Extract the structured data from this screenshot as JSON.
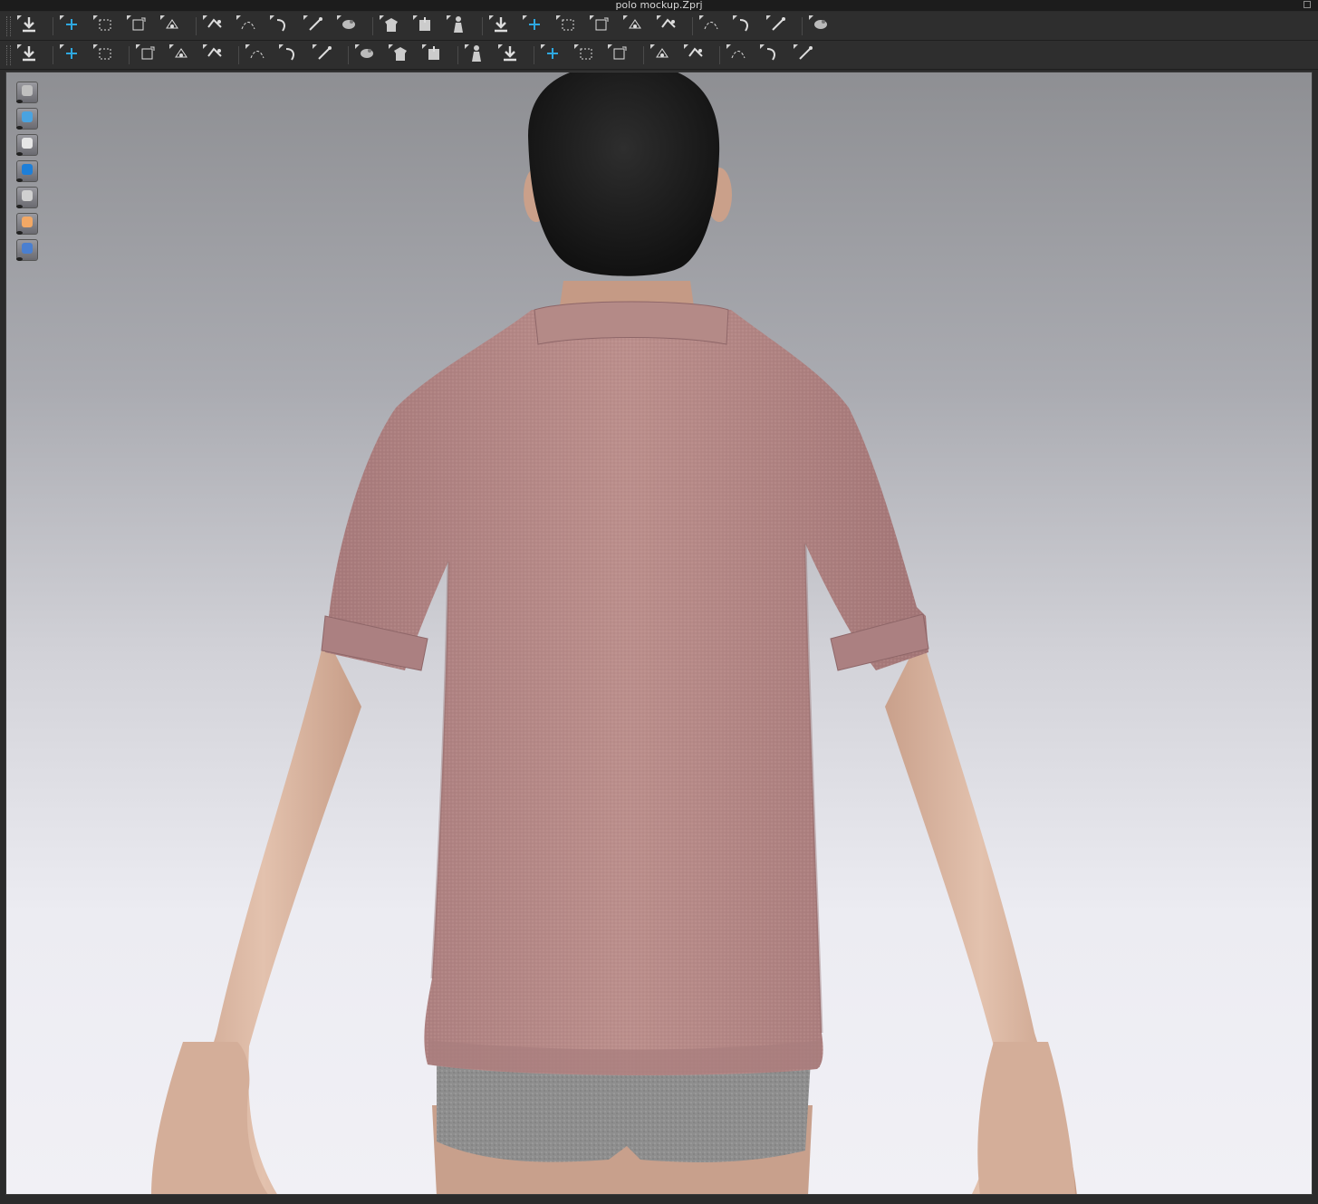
{
  "window": {
    "title": "polo mockup.Zprj"
  },
  "toolbar_row1": [
    {
      "name": "simulation-tool",
      "icon": "down-arrow-icon"
    },
    {
      "name": "select-move-tool",
      "icon": "select-cross-icon"
    },
    {
      "name": "select-mesh-box-tool",
      "icon": "box-select-icon"
    },
    {
      "name": "transform-tool",
      "icon": "transform-icon"
    },
    {
      "name": "fold-arrangement-tool",
      "icon": "fold-icon"
    },
    {
      "name": "edit-pattern-tool",
      "icon": "edit-pattern-icon"
    },
    {
      "name": "edit-curve-tool",
      "icon": "curve-icon"
    },
    {
      "name": "edit-sewing-tool",
      "icon": "sewing-icon"
    },
    {
      "name": "pin-tool",
      "icon": "pin-icon"
    },
    {
      "name": "tack-tool",
      "icon": "tack-icon"
    },
    {
      "name": "garment-fit-tool",
      "icon": "shirt-icon"
    },
    {
      "name": "arrangement-tool",
      "icon": "arrangement-icon"
    },
    {
      "name": "show-avatar-tool",
      "icon": "person-icon"
    },
    {
      "name": "shirt-up-tool",
      "icon": "shirt-up-icon"
    },
    {
      "name": "shirt-updown-tool",
      "icon": "shirt-updown-icon"
    },
    {
      "name": "shirt-down-tool",
      "icon": "shirt-down-icon"
    },
    {
      "name": "layer-tool",
      "icon": "layer-icon"
    },
    {
      "name": "stack-tool",
      "icon": "stack-icon"
    },
    {
      "name": "tape-tool",
      "icon": "tape-icon"
    },
    {
      "name": "steam-tool",
      "icon": "steam-icon"
    },
    {
      "name": "measure-tool",
      "icon": "measure-icon"
    },
    {
      "name": "circumference-tool",
      "icon": "ring-icon"
    },
    {
      "name": "ruler-tool",
      "icon": "ruler-icon"
    }
  ],
  "toolbar_row2": [
    {
      "name": "pose-tool",
      "icon": "walking-person-icon"
    },
    {
      "name": "brush-tool",
      "icon": "brush-icon"
    },
    {
      "name": "needle-tool",
      "icon": "needle-icon"
    },
    {
      "name": "line-stitch-tool",
      "icon": "stitch-icon"
    },
    {
      "name": "cross-stitch-tool",
      "icon": "cross-stitch-icon"
    },
    {
      "name": "copy-pattern-tool",
      "icon": "copy-icon"
    },
    {
      "name": "texture-tool",
      "icon": "texture-icon"
    },
    {
      "name": "fabric-tool",
      "icon": "fabric-icon"
    },
    {
      "name": "graphic-tool",
      "icon": "graphic-icon"
    },
    {
      "name": "button-tool",
      "icon": "button-icon"
    },
    {
      "name": "buttonhole-tool",
      "icon": "buttonhole-icon"
    },
    {
      "name": "topstitch-tool",
      "icon": "topstitch-icon"
    },
    {
      "name": "zipper-pull-tool",
      "icon": "zipper-pull-icon"
    },
    {
      "name": "zipper-tool",
      "icon": "zipper-icon"
    },
    {
      "name": "puckering-tool",
      "icon": "puckering-icon"
    },
    {
      "name": "piping-tool",
      "icon": "piping-icon"
    },
    {
      "name": "elastic-tool",
      "icon": "elastic-icon"
    },
    {
      "name": "fold-tool",
      "icon": "fold-line-icon"
    },
    {
      "name": "resize-tool",
      "icon": "resize-icon"
    },
    {
      "name": "shirt-fit-tool",
      "icon": "shirt-fit-icon"
    },
    {
      "name": "shirt-style-tool",
      "icon": "shirt-style-icon"
    },
    {
      "name": "lips-tool",
      "icon": "lips-icon"
    }
  ],
  "viewport_tools": [
    {
      "name": "show-garment",
      "icon": "shirt-icon",
      "color": "#bfbfbf"
    },
    {
      "name": "show-sewing",
      "icon": "sewing-needle-icon",
      "color": "#4aa3e0"
    },
    {
      "name": "show-avatar-pose",
      "icon": "person-icon",
      "color": "#e6e6e6"
    },
    {
      "name": "show-fabric",
      "icon": "fabric-roll-icon",
      "color": "#1e7fd8"
    },
    {
      "name": "show-pressure",
      "icon": "pressure-icon",
      "color": "#d0d0d0"
    },
    {
      "name": "show-avatar",
      "icon": "avatar-head-icon",
      "color": "#f2a865"
    },
    {
      "name": "show-environment",
      "icon": "globe-icon",
      "color": "#4a7fd0"
    }
  ],
  "colors": {
    "shirt": "#b08580",
    "skin": "#d8b09a",
    "hair": "#1e1e1e",
    "underwear": "#8f8f8f",
    "accent": "#2ea8e0"
  }
}
